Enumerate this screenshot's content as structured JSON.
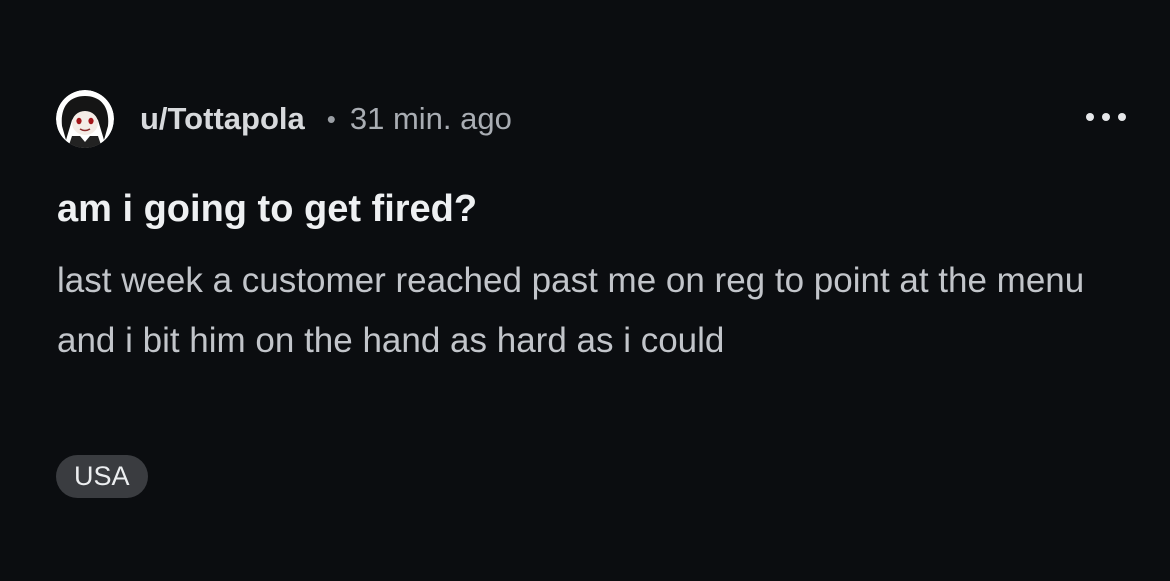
{
  "post": {
    "author": "u/Tottapola",
    "separator": "•",
    "time_ago": "31 min. ago",
    "title": "am i going to get fired?",
    "body": "last week a customer reached past me on reg to point at the menu and i bit him on the hand as hard as i could",
    "flair": "USA"
  },
  "icons": {
    "avatar": "anime-girl-avatar",
    "more": "more-options-icon"
  },
  "colors": {
    "background": "#0b0d10",
    "title": "#eef0f2",
    "body": "#c2c5ca",
    "flair_bg": "#3a3c40"
  }
}
